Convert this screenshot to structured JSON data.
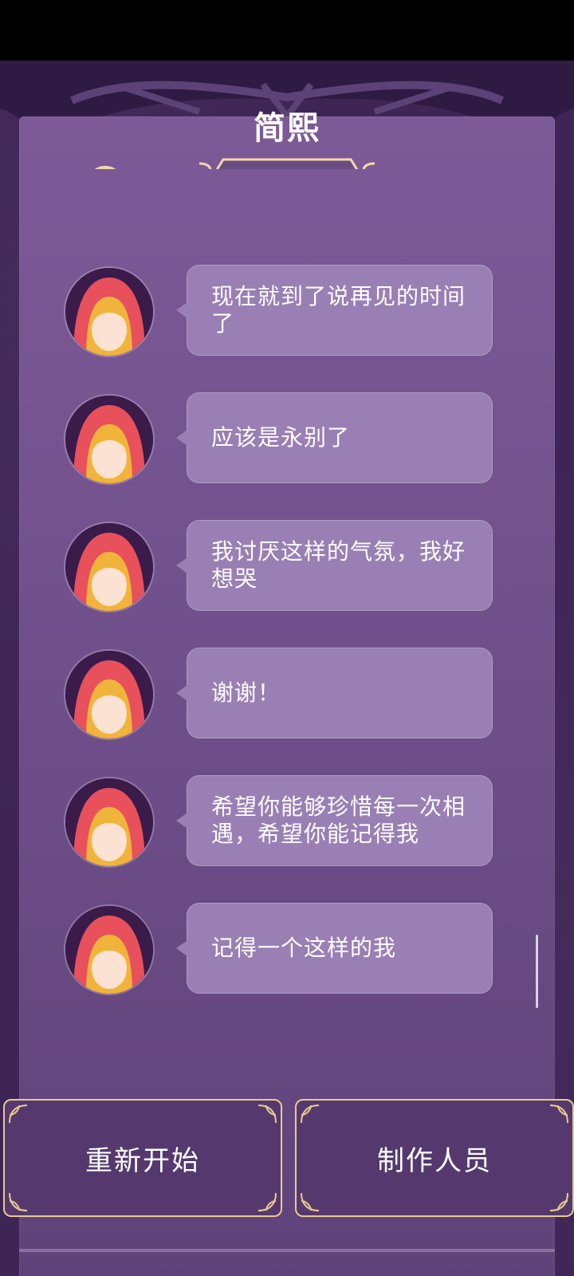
{
  "header": {
    "title": "简熙"
  },
  "messages": [
    {
      "text": "现在就到了说再见的时间了"
    },
    {
      "text": "应该是永别了"
    },
    {
      "text": "我讨厌这样的气氛，我好想哭"
    },
    {
      "text": "谢谢！"
    },
    {
      "text": "希望你能够珍惜每一次相遇，希望你能记得我"
    },
    {
      "text": "记得一个这样的我"
    }
  ],
  "buttons": {
    "restart_label": "重新开始",
    "credits_label": "制作人员"
  },
  "colors": {
    "background": "#3e2556",
    "panel": "#7c5a97",
    "bubble": "#9a7fb4",
    "gold": "#e9c98e"
  }
}
